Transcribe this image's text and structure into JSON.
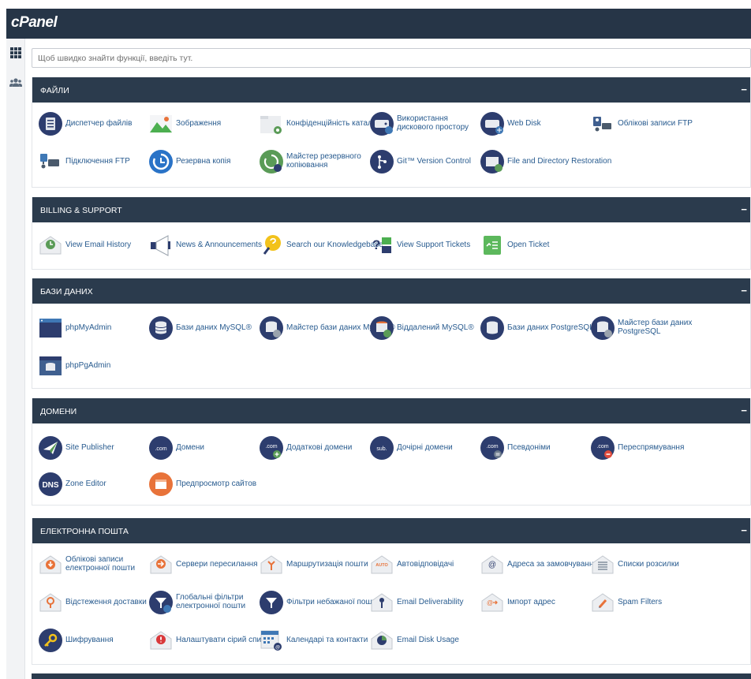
{
  "app": {
    "logo": "cPanel"
  },
  "search": {
    "placeholder": "Щоб швидко знайти функції, введіть тут."
  },
  "sections": {
    "files": {
      "title": "ФАЙЛИ",
      "toggle": "−",
      "items": [
        "Диспетчер файлів",
        "Зображення",
        "Конфіденційність каталогу",
        "Використання дискового простору",
        "Web Disk",
        "Облікові записи FTP",
        "Підключення FTP",
        "Резервна копія",
        "Майстер резервного копіювання",
        "Git™ Version Control",
        "File and Directory Restoration"
      ]
    },
    "billing": {
      "title": "BILLING & SUPPORT",
      "toggle": "−",
      "items": [
        "View Email History",
        "News & Announcements",
        "Search our Knowledgebase",
        "View Support Tickets",
        "Open Ticket"
      ]
    },
    "databases": {
      "title": "БАЗИ ДАНИХ",
      "toggle": "−",
      "items": [
        "phpMyAdmin",
        "Бази даних MySQL®",
        "Майстер бази даних MySQL®",
        "Віддалений MySQL®",
        "Бази даних PostgreSQL",
        "Майстер бази даних PostgreSQL",
        "phpPgAdmin"
      ]
    },
    "domains": {
      "title": "ДОМЕНИ",
      "toggle": "−",
      "items": [
        "Site Publisher",
        "Домени",
        "Додаткові домени",
        "Дочірні домени",
        "Псевдоніми",
        "Переспрямування",
        "Zone Editor",
        "Предпросмотр сайтов"
      ],
      "icon_text": {
        "dns": "DNS",
        "com": ".com",
        "sub": "sub."
      }
    },
    "email": {
      "title": "ЕЛЕКТРОННА ПОШТА",
      "toggle": "−",
      "items": [
        "Облікові записи електронної пошти",
        "Сервери пересилання",
        "Маршрутизація пошти",
        "Автовідповідачі",
        "Адреса за замовчуванням",
        "Списки розсилки",
        "Відстеження доставки",
        "Глобальні фільтри електронної пошти",
        "Фільтри небажаної пошти",
        "Email Deliverability",
        "Імпорт адрес",
        "Spam Filters",
        "Шифрування",
        "Налаштувати сірий список",
        "Календарі та контакти",
        "Email Disk Usage"
      ],
      "icon_text": {
        "auto": "AUTO"
      }
    }
  },
  "colors": {
    "header": "#2b3b4d",
    "topbar": "#263547",
    "link": "#285b8f",
    "icon_dark": "#2d3d6e",
    "icon_green": "#5a9b57",
    "icon_orange": "#e8733a"
  }
}
